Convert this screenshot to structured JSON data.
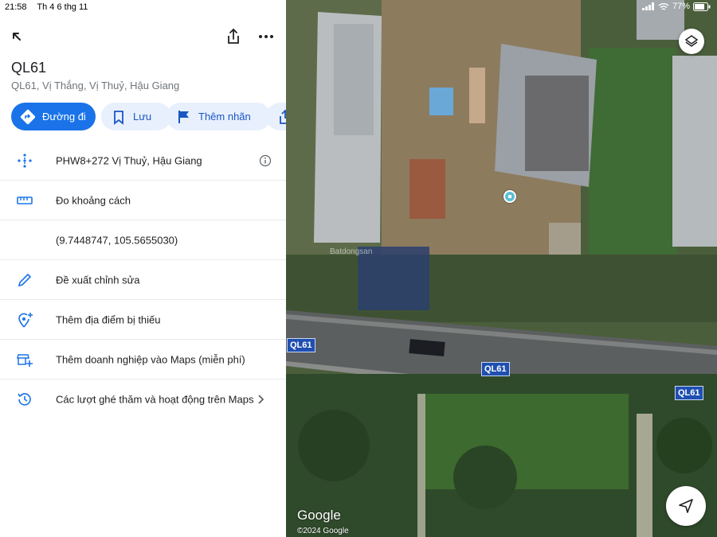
{
  "status_bar": {
    "time": "21:58",
    "date": "Th 4 6 thg 11",
    "battery": "77%"
  },
  "place": {
    "title": "QL61",
    "subtitle": "QL61, Vị Thắng, Vị Thuỷ, Hậu Giang"
  },
  "actions": {
    "directions": "Đường đi",
    "save": "Lưu",
    "label": "Thêm nhãn"
  },
  "details": [
    {
      "icon": "plus-code-icon",
      "text": "PHW8+272 Vị Thuỷ, Hậu Giang",
      "trailing": "info-icon"
    },
    {
      "icon": "ruler-icon",
      "text": "Đo khoảng cách"
    },
    {
      "icon": "",
      "text": "(9.7448747, 105.5655030)"
    },
    {
      "icon": "pencil-icon",
      "text": "Đề xuất chỉnh sửa"
    },
    {
      "icon": "add-place-icon",
      "text": "Thêm địa điểm bị thiếu"
    },
    {
      "icon": "add-business-icon",
      "text": "Thêm doanh nghiệp vào Maps (miễn phí)"
    },
    {
      "icon": "history-icon",
      "text": "Các lượt ghé thăm và hoạt động trên Maps",
      "trailing": "chevron-right-icon"
    }
  ],
  "map": {
    "road_labels": [
      "QL61",
      "QL61",
      "QL61"
    ],
    "logo": "Google",
    "copyright": "©2024 Google",
    "watermark": "Batdongsan"
  },
  "colors": {
    "accent": "#1a73e8",
    "chip_bg": "#e8f0fe",
    "road_label": "#1f4fb0"
  }
}
